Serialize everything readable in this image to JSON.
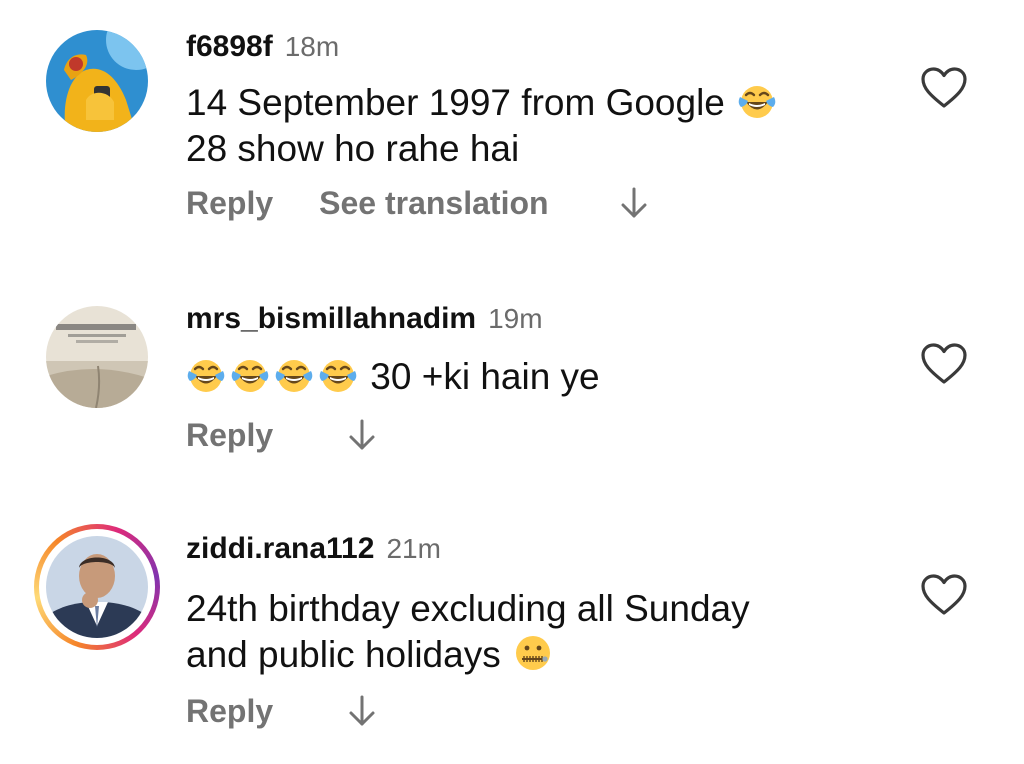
{
  "comments": [
    {
      "username": "f6898f",
      "time": "18m",
      "text_line1": "14 September 1997 from Google",
      "emoji1": "face-with-tears-of-joy",
      "text_line2": "28 show ho rahe hai",
      "reply_label": "Reply",
      "translate_label": "See translation"
    },
    {
      "username": "mrs_bismillahnadim",
      "time": "19m",
      "emojis": [
        "face-with-tears-of-joy",
        "face-with-tears-of-joy",
        "face-with-tears-of-joy",
        "face-with-tears-of-joy"
      ],
      "text_line1": "30 +ki hain ye",
      "reply_label": "Reply"
    },
    {
      "username": "ziddi.rana112",
      "time": "21m",
      "text_line1": "24th birthday excluding all Sunday",
      "text_line2": "and public holidays",
      "emoji1": "zipper-mouth-face",
      "reply_label": "Reply"
    }
  ],
  "colors": {
    "text": "#111111",
    "secondary": "#737373",
    "timestamp": "#6b6b6b",
    "background": "#ffffff"
  }
}
